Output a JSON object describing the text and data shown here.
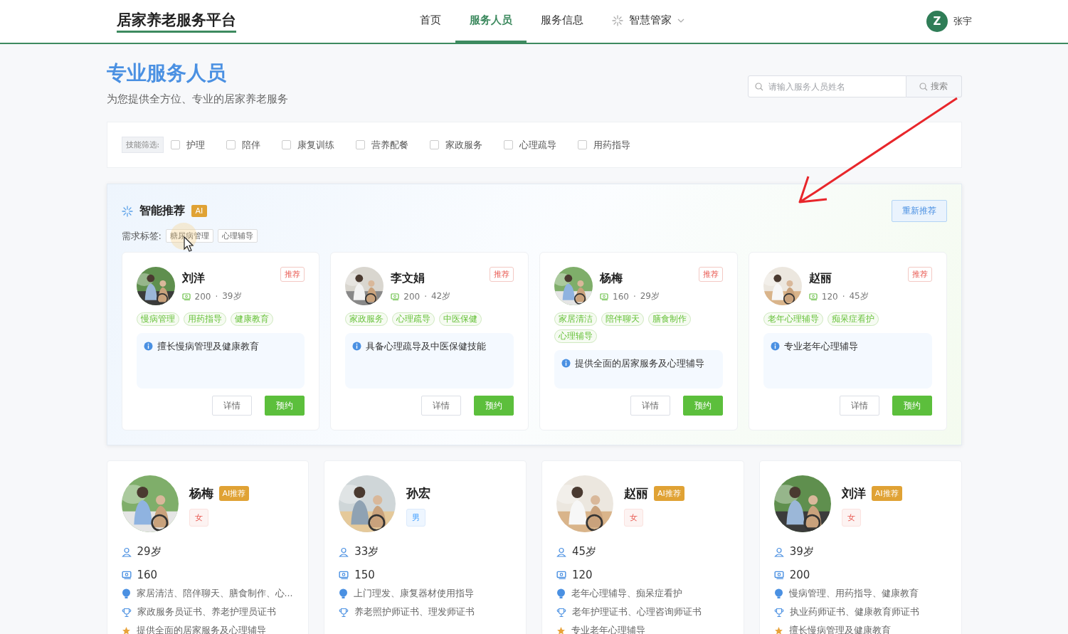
{
  "header": {
    "logo": "居家养老服务平台",
    "nav": [
      {
        "label": "首页",
        "selected": false,
        "kind": "link"
      },
      {
        "label": "服务人员",
        "selected": true,
        "kind": "link"
      },
      {
        "label": "服务信息",
        "selected": false,
        "kind": "link"
      },
      {
        "label": "智慧管家",
        "selected": false,
        "kind": "dropdown"
      }
    ],
    "user": {
      "initial": "Z",
      "name": "张宇"
    }
  },
  "page": {
    "title": "专业服务人员",
    "subtitle": "为您提供全方位、专业的居家养老服务"
  },
  "search": {
    "placeholder": "请输入服务人员姓名",
    "button": "搜索"
  },
  "filter": {
    "label": "技能筛选:",
    "options": [
      {
        "label": "护理",
        "checked": false
      },
      {
        "label": "陪伴",
        "checked": false
      },
      {
        "label": "康复训练",
        "checked": false
      },
      {
        "label": "营养配餐",
        "checked": false
      },
      {
        "label": "家政服务",
        "checked": false
      },
      {
        "label": "心理疏导",
        "checked": false
      },
      {
        "label": "用药指导",
        "checked": false
      }
    ]
  },
  "recommend": {
    "title": "智能推荐",
    "badge": "AI",
    "refresh": "重新推荐",
    "needs_label": "需求标签:",
    "needs": [
      "糖尿病管理",
      "心理辅导"
    ],
    "cards": [
      {
        "name": "刘洋",
        "badge": "推荐",
        "price": "200",
        "separator": "·",
        "age": "39岁",
        "tags": [
          "慢病管理",
          "用药指导",
          "健康教育"
        ],
        "note": "擅长慢病管理及健康教育",
        "details": "详情",
        "book": "预约"
      },
      {
        "name": "李文娟",
        "badge": "推荐",
        "price": "200",
        "separator": "·",
        "age": "42岁",
        "tags": [
          "家政服务",
          "心理疏导",
          "中医保健"
        ],
        "note": "具备心理疏导及中医保健技能",
        "details": "详情",
        "book": "预约"
      },
      {
        "name": "杨梅",
        "badge": "推荐",
        "price": "160",
        "separator": "·",
        "age": "29岁",
        "tags": [
          "家居清洁",
          "陪伴聊天",
          "膳食制作",
          "心理辅导"
        ],
        "note": "提供全面的居家服务及心理辅导",
        "details": "详情",
        "book": "预约"
      },
      {
        "name": "赵丽",
        "badge": "推荐",
        "price": "120",
        "separator": "·",
        "age": "45岁",
        "tags": [
          "老年心理辅导",
          "痴呆症看护"
        ],
        "note": "专业老年心理辅导",
        "details": "详情",
        "book": "预约"
      }
    ]
  },
  "staff": [
    {
      "name": "杨梅",
      "badge": "AI推荐",
      "gender": "女",
      "kind": "female",
      "age": "29岁",
      "price": "160",
      "skills": "家居清洁、陪伴聊天、膳食制作、心...",
      "certificates": "家政服务员证书、养老护理员证书",
      "specialty": "提供全面的居家服务及心理辅导"
    },
    {
      "name": "孙宏",
      "gender": "男",
      "kind": "male",
      "age": "33岁",
      "price": "150",
      "skills": "上门理发、康复器材使用指导",
      "certificates": "养老照护师证书、理发师证书"
    },
    {
      "name": "赵丽",
      "badge": "AI推荐",
      "gender": "女",
      "kind": "female",
      "age": "45岁",
      "price": "120",
      "skills": "老年心理辅导、痴呆症看护",
      "certificates": "老年护理证书、心理咨询师证书",
      "specialty": "专业老年心理辅导"
    },
    {
      "name": "刘洋",
      "badge": "AI推荐",
      "gender": "女",
      "kind": "female",
      "age": "39岁",
      "price": "200",
      "skills": "慢病管理、用药指导、健康教育",
      "certificates": "执业药师证书、健康教育师证书",
      "specialty": "擅长慢病管理及健康教育"
    }
  ]
}
